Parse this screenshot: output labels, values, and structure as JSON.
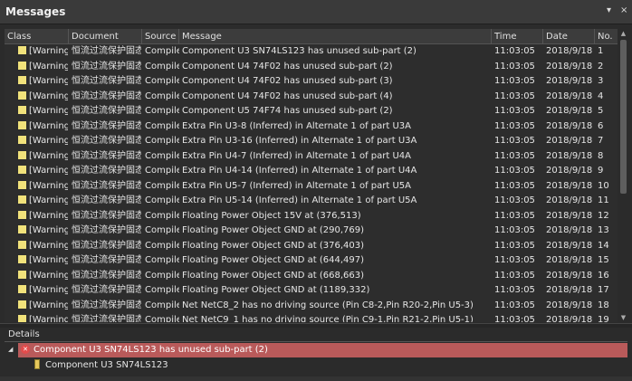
{
  "panel": {
    "title": "Messages",
    "pin_glyph": "▾",
    "close_glyph": "×"
  },
  "columns": [
    "Class",
    "Document",
    "Source",
    "Message",
    "Time",
    "Date",
    "No."
  ],
  "rows": [
    {
      "cls": "[Warning",
      "doc": "恒流过流保护固态",
      "src": "Compiler",
      "msg": "Component U3 SN74LS123 has unused sub-part (2)",
      "time": "11:03:05",
      "date": "2018/9/18",
      "no": "1"
    },
    {
      "cls": "[Warning",
      "doc": "恒流过流保护固态",
      "src": "Compiler",
      "msg": "Component U4 74F02 has unused sub-part (2)",
      "time": "11:03:05",
      "date": "2018/9/18",
      "no": "2"
    },
    {
      "cls": "[Warning",
      "doc": "恒流过流保护固态",
      "src": "Compiler",
      "msg": "Component U4 74F02 has unused sub-part (3)",
      "time": "11:03:05",
      "date": "2018/9/18",
      "no": "3"
    },
    {
      "cls": "[Warning",
      "doc": "恒流过流保护固态",
      "src": "Compiler",
      "msg": "Component U4 74F02 has unused sub-part (4)",
      "time": "11:03:05",
      "date": "2018/9/18",
      "no": "4"
    },
    {
      "cls": "[Warning",
      "doc": "恒流过流保护固态",
      "src": "Compiler",
      "msg": "Component U5 74F74 has unused sub-part (2)",
      "time": "11:03:05",
      "date": "2018/9/18",
      "no": "5"
    },
    {
      "cls": "[Warning",
      "doc": "恒流过流保护固态",
      "src": "Compiler",
      "msg": "Extra Pin U3-8 (Inferred) in Alternate 1 of part U3A",
      "time": "11:03:05",
      "date": "2018/9/18",
      "no": "6"
    },
    {
      "cls": "[Warning",
      "doc": "恒流过流保护固态",
      "src": "Compiler",
      "msg": "Extra Pin U3-16 (Inferred) in Alternate 1 of part U3A",
      "time": "11:03:05",
      "date": "2018/9/18",
      "no": "7"
    },
    {
      "cls": "[Warning",
      "doc": "恒流过流保护固态",
      "src": "Compiler",
      "msg": "Extra Pin U4-7 (Inferred) in Alternate 1 of part U4A",
      "time": "11:03:05",
      "date": "2018/9/18",
      "no": "8"
    },
    {
      "cls": "[Warning",
      "doc": "恒流过流保护固态",
      "src": "Compiler",
      "msg": "Extra Pin U4-14 (Inferred) in Alternate 1 of part U4A",
      "time": "11:03:05",
      "date": "2018/9/18",
      "no": "9"
    },
    {
      "cls": "[Warning",
      "doc": "恒流过流保护固态",
      "src": "Compiler",
      "msg": "Extra Pin U5-7 (Inferred) in Alternate 1 of part U5A",
      "time": "11:03:05",
      "date": "2018/9/18",
      "no": "10"
    },
    {
      "cls": "[Warning",
      "doc": "恒流过流保护固态",
      "src": "Compiler",
      "msg": "Extra Pin U5-14 (Inferred) in Alternate 1 of part U5A",
      "time": "11:03:05",
      "date": "2018/9/18",
      "no": "11"
    },
    {
      "cls": "[Warning",
      "doc": "恒流过流保护固态",
      "src": "Compiler",
      "msg": "Floating Power Object 15V at (376,513)",
      "time": "11:03:05",
      "date": "2018/9/18",
      "no": "12"
    },
    {
      "cls": "[Warning",
      "doc": "恒流过流保护固态",
      "src": "Compiler",
      "msg": "Floating Power Object GND at (290,769)",
      "time": "11:03:05",
      "date": "2018/9/18",
      "no": "13"
    },
    {
      "cls": "[Warning",
      "doc": "恒流过流保护固态",
      "src": "Compiler",
      "msg": "Floating Power Object GND at (376,403)",
      "time": "11:03:05",
      "date": "2018/9/18",
      "no": "14"
    },
    {
      "cls": "[Warning",
      "doc": "恒流过流保护固态",
      "src": "Compiler",
      "msg": "Floating Power Object GND at (644,497)",
      "time": "11:03:05",
      "date": "2018/9/18",
      "no": "15"
    },
    {
      "cls": "[Warning",
      "doc": "恒流过流保护固态",
      "src": "Compiler",
      "msg": "Floating Power Object GND at (668,663)",
      "time": "11:03:05",
      "date": "2018/9/18",
      "no": "16"
    },
    {
      "cls": "[Warning",
      "doc": "恒流过流保护固态",
      "src": "Compiler",
      "msg": "Floating Power Object GND at (1189,332)",
      "time": "11:03:05",
      "date": "2018/9/18",
      "no": "17"
    },
    {
      "cls": "[Warning",
      "doc": "恒流过流保护固态",
      "src": "Compiler",
      "msg": "Net NetC8_2 has no driving source (Pin C8-2,Pin R20-2,Pin U5-3)",
      "time": "11:03:05",
      "date": "2018/9/18",
      "no": "18"
    },
    {
      "cls": "[Warning",
      "doc": "恒流过流保护固态",
      "src": "Compiler",
      "msg": "Net NetC9_1 has no driving source (Pin C9-1,Pin R21-2,Pin U5-1)",
      "time": "11:03:05",
      "date": "2018/9/18",
      "no": "19"
    }
  ],
  "details": {
    "title": "Details",
    "selected_message": "Component U3 SN74LS123 has unused sub-part (2)",
    "child": "Component U3 SN74LS123",
    "error_glyph": "✕",
    "expand_glyph": "◢"
  },
  "icons": {
    "warning_color": "#f1e27b",
    "error_color": "#e24c4c",
    "selected_row_color": "#b95a5a"
  }
}
